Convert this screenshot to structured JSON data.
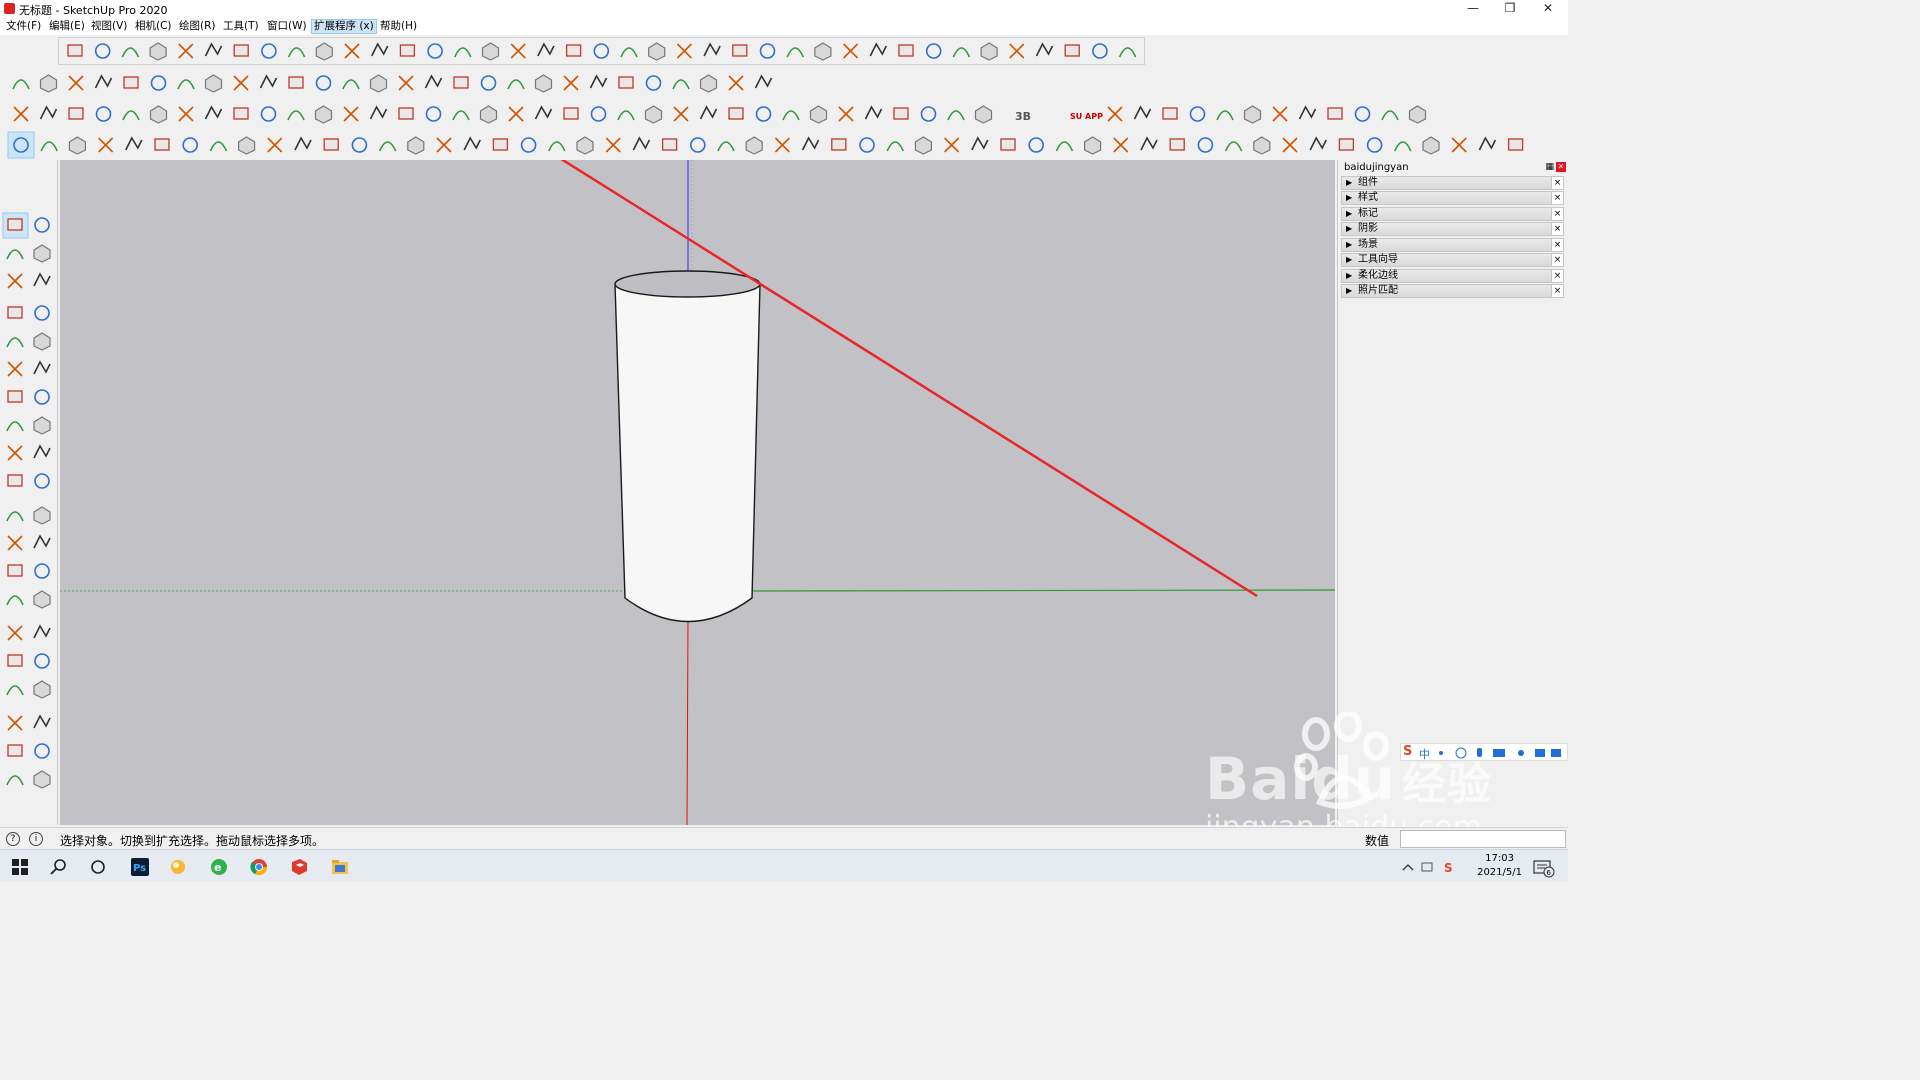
{
  "window": {
    "title": "无标题 - SketchUp Pro 2020",
    "controls": [
      "minimize-icon",
      "restore-icon",
      "close-icon"
    ]
  },
  "menu": {
    "items": [
      {
        "label": "文件(F)"
      },
      {
        "label": "编辑(E)"
      },
      {
        "label": "视图(V)"
      },
      {
        "label": "相机(C)"
      },
      {
        "label": "绘图(R)"
      },
      {
        "label": "工具(T)"
      },
      {
        "label": "窗口(W)"
      },
      {
        "label": "扩展程序 (x)",
        "active": true
      },
      {
        "label": "帮助(H)"
      }
    ]
  },
  "toolbars": {
    "row1_icons": [
      "line-tools-icon",
      "arc-tools-icon",
      "shape-tools-icon",
      "edit-tools-icon",
      "extension-tools-icon"
    ],
    "row3_badges": [
      "3B",
      "SU APP"
    ],
    "row4_tools": [
      "select-icon",
      "eraser-icon",
      "freehand-icon",
      "line-icon",
      "circle-icon",
      "push-pull-icon",
      "follow-me-icon",
      "move-icon",
      "rotate-icon",
      "scale-icon",
      "tape-measure-icon",
      "text-icon",
      "paint-bucket-icon",
      "orbit-icon",
      "pan-icon",
      "zoom-icon",
      "zoom-extents-icon",
      "warehouse-icon",
      "extension-warehouse-icon",
      "layout-icon",
      "ruby-icon",
      "user-icon",
      "views-icon",
      "styles-icon",
      "house-icon",
      "sandbox-icon"
    ]
  },
  "left_toolbar": {
    "tools": [
      "select-icon",
      "make-component-icon",
      "paint-bucket-icon",
      "eraser-icon",
      "line-icon",
      "freehand-icon",
      "rectangle-icon",
      "rotated-rectangle-icon",
      "circle-icon",
      "polygon-icon",
      "arc-icon",
      "pie-icon",
      "two-point-arc-icon",
      "three-point-arc-icon",
      "move-icon",
      "push-pull-icon",
      "rotate-icon",
      "follow-me-icon",
      "scale-icon",
      "offset-icon",
      "tape-measure-icon",
      "dimension-icon",
      "protractor-icon",
      "text-icon",
      "axes-icon",
      "3d-text-icon",
      "orbit-icon",
      "pan-icon",
      "zoom-icon",
      "zoom-window-icon",
      "zoom-extents-icon",
      "previous-view-icon",
      "position-camera-icon",
      "look-around-icon",
      "walk-icon",
      "section-plane-icon",
      "warehouse-icon",
      "extension-warehouse-icon",
      "send-to-layout-icon",
      "ruby-console-icon"
    ]
  },
  "tray": {
    "title": "baidujingyan",
    "panels": [
      {
        "label": "组件"
      },
      {
        "label": "样式"
      },
      {
        "label": "标记"
      },
      {
        "label": "阴影"
      },
      {
        "label": "场景"
      },
      {
        "label": "工具向导"
      },
      {
        "label": "柔化边线"
      },
      {
        "label": "照片匹配"
      }
    ]
  },
  "viewport": {
    "model": "cylinder",
    "background_color": "#c2c2c6",
    "annotation_color": "#e8262b"
  },
  "status": {
    "hint": "选择对象。切换到扩充选择。拖动鼠标选择多项。",
    "measurements_label": "数值",
    "measurements_value": ""
  },
  "taskbar": {
    "apps": [
      "windows-start-icon",
      "search-icon",
      "task-view-icon",
      "photoshop-icon",
      "app-icon",
      "browser-icon",
      "chrome-icon",
      "sketchup-icon",
      "file-explorer-icon"
    ],
    "time": "17:03",
    "date": "2021/5/1",
    "notifications": "6"
  },
  "ime": {
    "label": "中"
  },
  "watermark": {
    "brand": "Baidu",
    "brand_cn": "经验",
    "url": "jingyan.baidu.com"
  }
}
